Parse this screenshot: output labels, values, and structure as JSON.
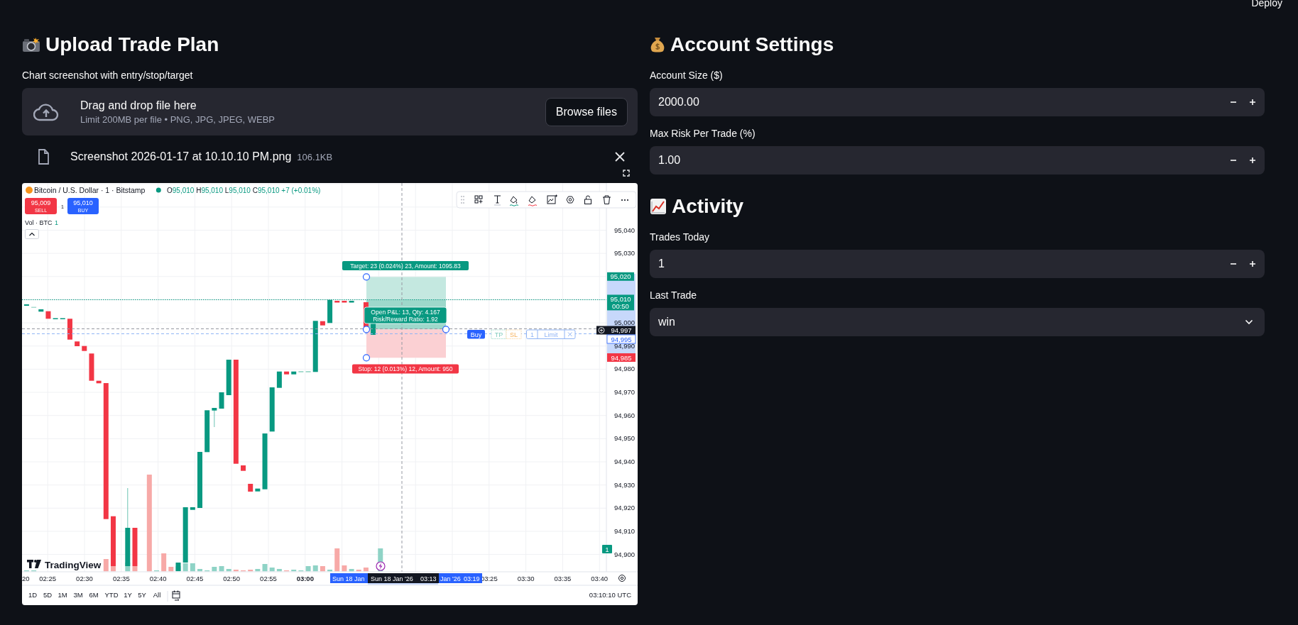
{
  "header": {
    "deploy": "Deploy"
  },
  "upload": {
    "title": "Upload Trade Plan",
    "label": "Chart screenshot with entry/stop/target",
    "dropzone": {
      "title": "Drag and drop file here",
      "hint": "Limit 200MB per file • PNG, JPG, JPEG, WEBP",
      "button": "Browse files"
    },
    "file": {
      "name": "Screenshot 2026-01-17 at 10.10.10 PM.png",
      "size": "106.1KB"
    }
  },
  "chart_image": {
    "symbol": "Bitcoin / U.S. Dollar · 1 · Bitstamp",
    "ohlc": [
      {
        "letter": "O",
        "value": "95,010"
      },
      {
        "letter": "H",
        "value": "95,010"
      },
      {
        "letter": "L",
        "value": "95,010"
      },
      {
        "letter": "C",
        "value": "95,010"
      }
    ],
    "change": "+7 (+0.01%)",
    "sell": {
      "price": "95,009",
      "label": "SELL"
    },
    "quantity": "1",
    "buy": {
      "price": "95,010",
      "label": "BUY"
    },
    "volume_label": "Vol · BTC",
    "volume_value": "1",
    "price_axis": [
      {
        "label": "95,040",
        "kind": "tick"
      },
      {
        "label": "95,030",
        "kind": "tick"
      },
      {
        "label": "95,020",
        "kind": "target"
      },
      {
        "label": "95,010",
        "sub": "00:50",
        "kind": "last"
      },
      {
        "label": "95,000",
        "kind": "tick"
      },
      {
        "label": "94,990",
        "kind": "tick"
      },
      {
        "label": "94,980",
        "kind": "tick"
      },
      {
        "label": "94,970",
        "kind": "tick"
      },
      {
        "label": "94,960",
        "kind": "tick"
      },
      {
        "label": "94,950",
        "kind": "tick"
      },
      {
        "label": "94,940",
        "kind": "tick"
      },
      {
        "label": "94,930",
        "kind": "tick"
      },
      {
        "label": "94,920",
        "kind": "tick"
      },
      {
        "label": "94,910",
        "kind": "tick"
      },
      {
        "label": "94,900",
        "kind": "tick"
      }
    ],
    "price_markers": [
      {
        "label": "94,997",
        "kind": "cursor"
      },
      {
        "label": "94,995",
        "kind": "entry"
      },
      {
        "label": "94,985",
        "kind": "stop"
      }
    ],
    "position": {
      "target": "Target: 23 (0.024%) 23, Amount: 1095.83",
      "pnl": "Open P&L: 13, Qty: 4.167",
      "ratio": "Risk/Reward Ratio: 1.92",
      "stop": "Stop: 12 (0.013%) 12, Amount: 950"
    },
    "order": {
      "side": "Buy",
      "tp": "TP",
      "sl": "SL",
      "quantity": "1",
      "type": "Limit"
    },
    "volume_badge": "1",
    "time_axis": [
      {
        "label": "20",
        "bold": false
      },
      {
        "label": "02:25",
        "bold": false
      },
      {
        "label": "02:30",
        "bold": false
      },
      {
        "label": "02:35",
        "bold": false
      },
      {
        "label": "02:40",
        "bold": false
      },
      {
        "label": "02:45",
        "bold": false
      },
      {
        "label": "02:50",
        "bold": false
      },
      {
        "label": "02:55",
        "bold": false
      },
      {
        "label": "03:00",
        "bold": true
      },
      {
        "label": "03:25",
        "bold": false
      },
      {
        "label": "03:30",
        "bold": false
      },
      {
        "label": "03:35",
        "bold": false
      },
      {
        "label": "03:40",
        "bold": false
      }
    ],
    "range_start": "Sun 18 Jan",
    "cursor_date": "Sun 18 Jan '26",
    "cursor_time": "03:13",
    "range_end_date": "Jan '26",
    "range_end_time": "03:19",
    "logo": "TradingView",
    "timeframes": [
      "1D",
      "5D",
      "1M",
      "3M",
      "6M",
      "YTD",
      "1Y",
      "5Y",
      "All"
    ],
    "clock": "03:10:10 UTC"
  },
  "account": {
    "title": "Account Settings",
    "fields": [
      {
        "label": "Account Size ($)",
        "value": "2000.00",
        "kind": "number"
      },
      {
        "label": "Max Risk Per Trade (%)",
        "value": "1.00",
        "kind": "number"
      }
    ]
  },
  "activity": {
    "title": "Activity",
    "fields": [
      {
        "label": "Trades Today",
        "value": "1",
        "kind": "number"
      },
      {
        "label": "Last Trade",
        "value": "win",
        "kind": "select"
      }
    ]
  }
}
